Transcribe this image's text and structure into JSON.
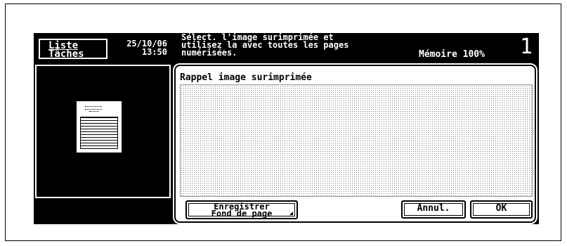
{
  "header": {
    "jobs_button_line1": "Liste",
    "jobs_button_line2": "Tâches",
    "date": "25/10/06",
    "time": "13:50",
    "message": "Sélect. l'image surimprimée et\nutilisez la avec toutes les pages\nnumérisées.",
    "memory": "Mémoire 100%",
    "copies": "1"
  },
  "panel": {
    "title": "Rappel image surimprimée"
  },
  "buttons": {
    "save_line1": "Enregistrer",
    "save_line2": "Fond de page",
    "cancel": "Annul.",
    "ok": "OK"
  },
  "icons": {
    "document_preview": "document-preview-icon"
  }
}
